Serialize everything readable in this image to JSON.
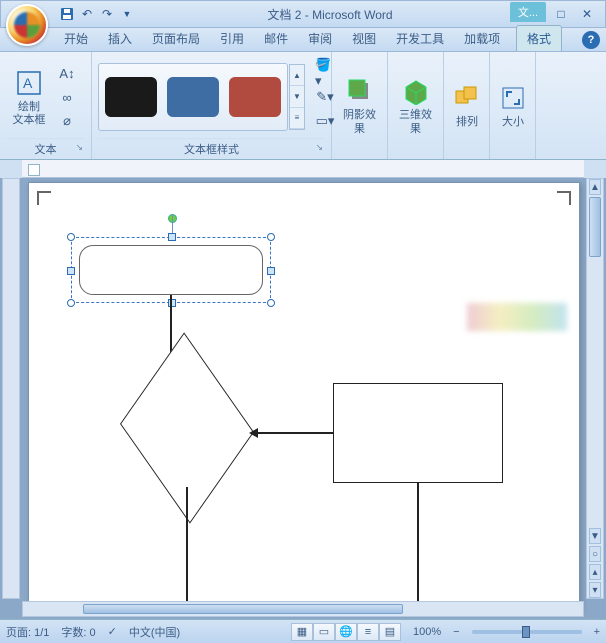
{
  "app": {
    "title": "文档 2 - Microsoft Word"
  },
  "context_tab_header": "文...",
  "qat": {
    "save": "save-icon",
    "undo": "undo-icon",
    "redo": "redo-icon",
    "more": "qat-more"
  },
  "tabs": {
    "items": [
      "开始",
      "插入",
      "页面布局",
      "引用",
      "邮件",
      "审阅",
      "视图",
      "开发工具",
      "加载项"
    ],
    "contextual": "格式"
  },
  "ribbon": {
    "group_text": {
      "label": "文本",
      "draw_textbox": "绘制\n文本框"
    },
    "group_styles": {
      "label": "文本框样式",
      "swatches": [
        "#1a1a1a",
        "#3d6da3",
        "#b14a3f"
      ]
    },
    "group_shadow": {
      "label": "阴影效果"
    },
    "group_3d": {
      "label": "三维效果"
    },
    "group_arrange": {
      "label": "排列"
    },
    "group_size": {
      "label": "大小"
    }
  },
  "status": {
    "page": "页面: 1/1",
    "words": "字数: 0",
    "lang": "中文(中国)",
    "zoom": "100%"
  },
  "icons": {
    "link": "∞",
    "direction": "↕",
    "fill": "◆",
    "outline": "✎",
    "shape": "▭",
    "shadow": "▧",
    "threeD": "◧",
    "arrange": "⬚",
    "size": "⇲",
    "help": "?"
  }
}
